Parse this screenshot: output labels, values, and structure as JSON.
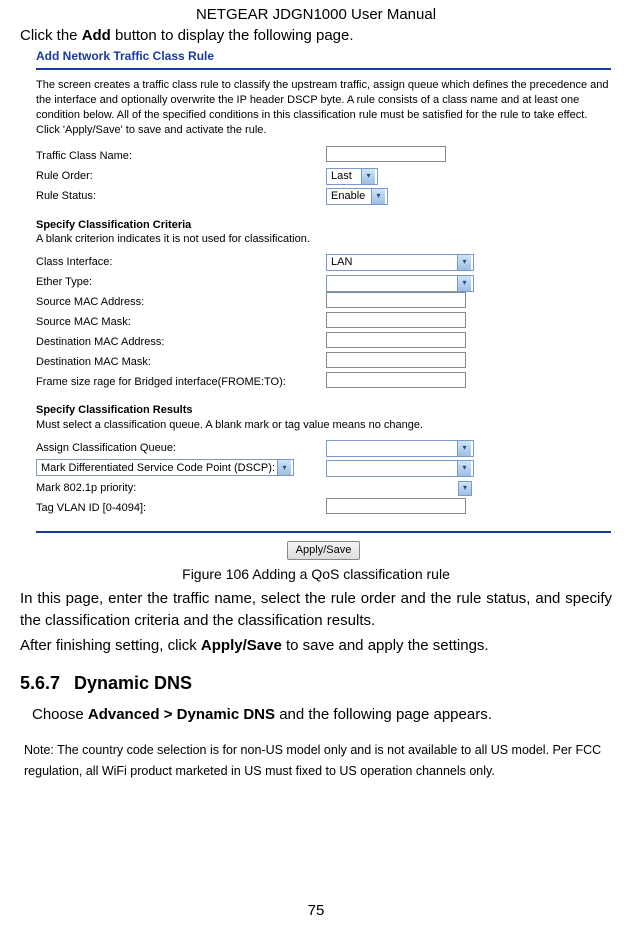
{
  "header": "NETGEAR JDGN1000 User Manual",
  "intro": {
    "prefix": "Click the ",
    "bold": "Add",
    "suffix": " button to display the following page."
  },
  "screenshot": {
    "title": "Add Network Traffic Class Rule",
    "description": "The screen creates a traffic class rule to classify the upstream traffic, assign queue which defines the precedence and the interface and optionally overwrite the IP header DSCP byte. A rule consists of a class name and at least one condition below. All of the specified conditions in this classification rule must be satisfied for the rule to take effect. Click 'Apply/Save' to save and activate the rule.",
    "fields": {
      "traffic_class_name": "Traffic Class Name:",
      "rule_order": "Rule Order:",
      "rule_order_value": "Last",
      "rule_status": "Rule Status:",
      "rule_status_value": "Enable"
    },
    "criteria": {
      "title": "Specify Classification Criteria",
      "sub": "A blank criterion indicates it is not used for classification.",
      "class_interface": "Class Interface:",
      "class_interface_value": "LAN",
      "ether_type": "Ether Type:",
      "source_mac": "Source MAC Address:",
      "source_mask": "Source MAC Mask:",
      "dest_mac": "Destination MAC Address:",
      "dest_mask": "Destination MAC Mask:",
      "frame_size": "Frame size rage for Bridged interface(FROME:TO):"
    },
    "results": {
      "title": "Specify Classification Results",
      "sub": "Must select a classification queue. A blank mark or tag value means no change.",
      "assign_queue": "Assign Classification Queue:",
      "dscp": "Mark Differentiated Service Code Point (DSCP):",
      "mark_8021p": "Mark 802.1p priority:",
      "tag_vlan": "Tag VLAN ID [0-4094]:"
    },
    "apply_button": "Apply/Save"
  },
  "caption": "Figure 106 Adding a QoS classification rule",
  "body1": "In this page, enter the traffic name, select the rule order and the rule status, and specify the classification criteria and the classification results.",
  "body2_prefix": "After finishing setting, click ",
  "body2_bold": "Apply/Save",
  "body2_suffix": " to save and apply the settings.",
  "section": {
    "number": "5.6.7",
    "title": "Dynamic DNS",
    "text_prefix": "Choose ",
    "text_bold": "Advanced > Dynamic DNS",
    "text_suffix": " and the following page appears."
  },
  "note": "Note: The country code selection is for non-US model only and is not available to all US model. Per FCC regulation, all WiFi product marketed in US must fixed to US operation channels only.",
  "page_number": "75"
}
